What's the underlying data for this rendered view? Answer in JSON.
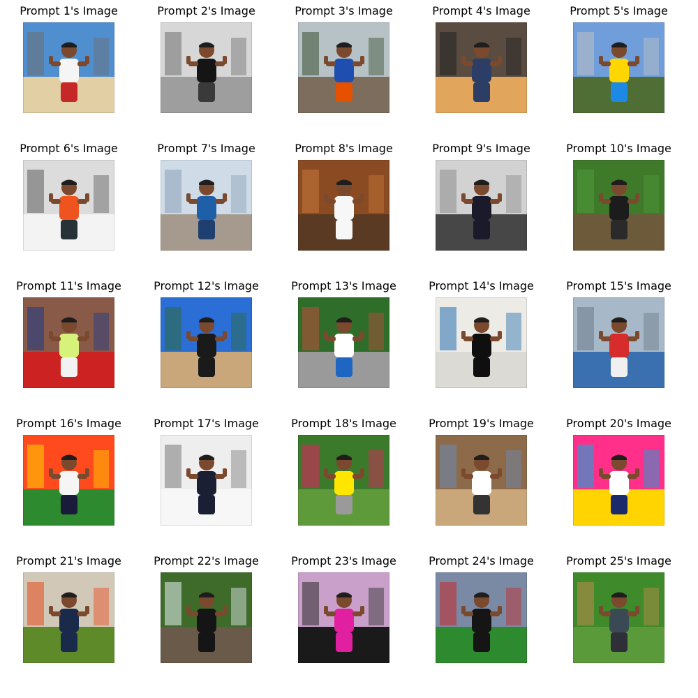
{
  "cells": [
    {
      "caption": "Prompt 1's Image",
      "palette": {
        "sky": "#4f8fd0",
        "ground": "#e3cfa4",
        "shirt": "#f5f5f5",
        "pants": "#c62828",
        "accent": "#6d6d6d"
      }
    },
    {
      "caption": "Prompt 2's Image",
      "palette": {
        "sky": "#d7d7d7",
        "ground": "#9e9e9e",
        "shirt": "#151515",
        "pants": "#3a3a3a",
        "accent": "#6f6f6f"
      }
    },
    {
      "caption": "Prompt 3's Image",
      "palette": {
        "sky": "#b7c2c7",
        "ground": "#7c6d5d",
        "shirt": "#1e4fb0",
        "pants": "#e65100",
        "accent": "#3a5030"
      }
    },
    {
      "caption": "Prompt 4's Image",
      "palette": {
        "sky": "#5a4c40",
        "ground": "#e2a55c",
        "shirt": "#2c3e66",
        "pants": "#2c3e66",
        "accent": "#222222"
      }
    },
    {
      "caption": "Prompt 5's Image",
      "palette": {
        "sky": "#6f9edb",
        "ground": "#4f6e36",
        "shirt": "#ffd600",
        "pants": "#1e88e5",
        "accent": "#c0c0c0"
      }
    },
    {
      "caption": "Prompt 6's Image",
      "palette": {
        "sky": "#dcdcdc",
        "ground": "#f3f3f3",
        "shirt": "#f0541e",
        "pants": "#263238",
        "accent": "#5c5c5c"
      }
    },
    {
      "caption": "Prompt 7's Image",
      "palette": {
        "sky": "#cfdce8",
        "ground": "#a59a8d",
        "shirt": "#1f5fa8",
        "pants": "#1f3f70",
        "accent": "#8aa0b5"
      }
    },
    {
      "caption": "Prompt 8's Image",
      "palette": {
        "sky": "#8a4a22",
        "ground": "#5a3a22",
        "shirt": "#f7f7f7",
        "pants": "#f7f7f7",
        "accent": "#c67a3a"
      }
    },
    {
      "caption": "Prompt 9's Image",
      "palette": {
        "sky": "#d2d2d2",
        "ground": "#474747",
        "shirt": "#1a1a2a",
        "pants": "#1a1a2a",
        "accent": "#8c8c8c"
      }
    },
    {
      "caption": "Prompt 10's Image",
      "palette": {
        "sky": "#3f7a2a",
        "ground": "#6d5a3a",
        "shirt": "#1c1c1c",
        "pants": "#2a2a2a",
        "accent": "#4f9a3a"
      }
    },
    {
      "caption": "Prompt 11's Image",
      "palette": {
        "sky": "#8a5a48",
        "ground": "#cc2222",
        "shirt": "#d7f27a",
        "pants": "#f2f2f2",
        "accent": "#1a3a8a"
      }
    },
    {
      "caption": "Prompt 12's Image",
      "palette": {
        "sky": "#2b6ed6",
        "ground": "#c9a77a",
        "shirt": "#1a1a1a",
        "pants": "#1a1a1a",
        "accent": "#2f6a3a"
      }
    },
    {
      "caption": "Prompt 13's Image",
      "palette": {
        "sky": "#2e6e2a",
        "ground": "#9a9a9a",
        "shirt": "#ffffff",
        "pants": "#1e66c2",
        "accent": "#c24a3a"
      }
    },
    {
      "caption": "Prompt 14's Image",
      "palette": {
        "sky": "#ecebe6",
        "ground": "#dcdad4",
        "shirt": "#0f0f0f",
        "pants": "#0f0f0f",
        "accent": "#2a6fb0"
      }
    },
    {
      "caption": "Prompt 15's Image",
      "palette": {
        "sky": "#a7b9c9",
        "ground": "#3a70b0",
        "shirt": "#d62c2c",
        "pants": "#f0f0f0",
        "accent": "#6e7a88"
      }
    },
    {
      "caption": "Prompt 16's Image",
      "palette": {
        "sky": "#ff4a1e",
        "ground": "#2e8a2e",
        "shirt": "#f5f5f5",
        "pants": "#1a1a3a",
        "accent": "#ffd400"
      }
    },
    {
      "caption": "Prompt 17's Image",
      "palette": {
        "sky": "#eeeeee",
        "ground": "#f7f7f7",
        "shirt": "#1a1f33",
        "pants": "#1a1f33",
        "accent": "#7a7a7a"
      }
    },
    {
      "caption": "Prompt 18's Image",
      "palette": {
        "sky": "#3a7a2a",
        "ground": "#5f9a3a",
        "shirt": "#ffe600",
        "pants": "#9a9a9a",
        "accent": "#e91e63"
      }
    },
    {
      "caption": "Prompt 19's Image",
      "palette": {
        "sky": "#8c6a4a",
        "ground": "#c9a77a",
        "shirt": "#ffffff",
        "pants": "#333333",
        "accent": "#6a8ab5"
      }
    },
    {
      "caption": "Prompt 20's Image",
      "palette": {
        "sky": "#ff2f8a",
        "ground": "#ffd400",
        "shirt": "#ffffff",
        "pants": "#1a2a6a",
        "accent": "#00b0e0"
      }
    },
    {
      "caption": "Prompt 21's Image",
      "palette": {
        "sky": "#d2c8b8",
        "ground": "#5f8a2a",
        "shirt": "#1a2a4a",
        "pants": "#1a2a4a",
        "accent": "#e84a1a"
      }
    },
    {
      "caption": "Prompt 22's Image",
      "palette": {
        "sky": "#3e6a2a",
        "ground": "#6a5a4a",
        "shirt": "#151515",
        "pants": "#151515",
        "accent": "#e6f0f6"
      }
    },
    {
      "caption": "Prompt 23's Image",
      "palette": {
        "sky": "#c9a0c9",
        "ground": "#1a1a1a",
        "shirt": "#e020a0",
        "pants": "#e020a0",
        "accent": "#2a2a2a"
      }
    },
    {
      "caption": "Prompt 24's Image",
      "palette": {
        "sky": "#7a8aa5",
        "ground": "#2e8a2e",
        "shirt": "#151515",
        "pants": "#151515",
        "accent": "#c62828"
      }
    },
    {
      "caption": "Prompt 25's Image",
      "palette": {
        "sky": "#3f8a2a",
        "ground": "#5a9a3a",
        "shirt": "#3a4a55",
        "pants": "#2f2f3a",
        "accent": "#c08a4a"
      }
    }
  ]
}
